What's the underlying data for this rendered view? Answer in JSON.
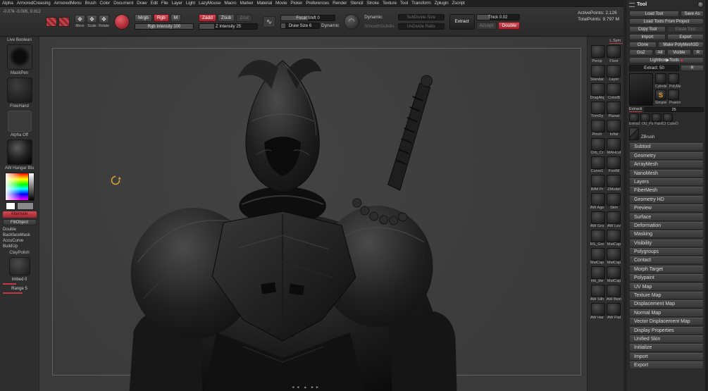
{
  "menu": {
    "items": [
      "Alpha",
      "ArmoredCreasing",
      "ArmoredMenu",
      "Brush",
      "Color",
      "Document",
      "Draw",
      "Edit",
      "File",
      "Layer",
      "Light",
      "LazyMouse",
      "Macro",
      "Marker",
      "Material",
      "Movie",
      "Picker",
      "Preferences",
      "Render",
      "Stencil",
      "Stroke",
      "Texture",
      "Tool",
      "Transform",
      "Zplugin",
      "Zscript"
    ]
  },
  "toolbar": {
    "coords": "-0.07k -0.005, 0.012",
    "tool_buttons": [
      "Move",
      "Scale",
      "Rotate"
    ],
    "mrgb": "Mrgb",
    "rgb": "Rgb",
    "m": "M",
    "rgb_intensity": "Rgb Intensity 100",
    "zadd": "Zadd",
    "zsub": "Zsub",
    "zcut": "Zcut",
    "z_intensity": "Z Intensity 25",
    "focal_shift": "Focal Shift 0",
    "draw_size": "Draw Size 6",
    "dynamic_small": "Dynamic",
    "dynamic": "Dynamic",
    "smooth_subdiv": "SmoothSubdiv",
    "subdivide_size": "SubDivide Size",
    "undivide_ratio": "UnDivide Ratio",
    "thick": "Thick 0.02",
    "extract": "Extract",
    "accept": "Accept",
    "double": "Double",
    "active_points": "ActivePoints: 2,126",
    "total_points": "TotalPoints: 9.797 M"
  },
  "left_shelf": {
    "live_boolean": "Live Boolean",
    "maskpen": "MaskPen",
    "freehand": "FreeHand",
    "alpha_off": "Alpha Off",
    "material": "AW Hangar Blu",
    "alternate": "Alternate",
    "fill_object": "FillObject",
    "toggles": [
      "Double",
      "BackfaceMask",
      "AccuCurve",
      "BuildUp"
    ],
    "clay_polish": "ClayPolish",
    "imbed": "Imbed 0",
    "range": "Range 5"
  },
  "canvas": {
    "nav_hint": "◄◄ ▲ ►►"
  },
  "right_tray": {
    "lsym": "L.Sym",
    "persp": "Persp",
    "floor": "Floor",
    "rows": [
      {
        "a": "Standar",
        "b": "Layer"
      },
      {
        "a": "DragAlq",
        "b": "ColorB"
      },
      {
        "a": "TrimDy",
        "b": "Planar"
      },
      {
        "a": "Pinch",
        "b": "Inflat"
      },
      {
        "a": "Orb_Cr",
        "b": "MAHcut"
      },
      {
        "a": "Curve1",
        "b": "FootM"
      },
      {
        "a": "IMM Pr",
        "b": "ZModel"
      },
      {
        "a": "AW Age",
        "b": "Skin"
      },
      {
        "a": "AW Gra",
        "b": "AW Lev"
      },
      {
        "a": "RS_Gre",
        "b": "MatCap"
      },
      {
        "a": "MatCap",
        "b": "MatCap"
      },
      {
        "a": "mb_bw",
        "b": "MatCap"
      },
      {
        "a": "AW Silh",
        "b": "AW Bion"
      },
      {
        "a": "AW Har",
        "b": "AW Flat"
      }
    ]
  },
  "tool_panel": {
    "title": "Tool",
    "load_tool": "Load Tool",
    "save_as": "Save As",
    "load_tools_project": "Load Tools From Project",
    "copy_tool": "Copy Tool",
    "paste_tool": "Paste Tool",
    "import": "Import",
    "export": "Export",
    "clone": "Clone",
    "make_polymesh": "Make PolyMesh3D",
    "goz": "GoZ",
    "all": "All",
    "visible": "Visible",
    "r": "R",
    "lightbox_tools": "Lightbox▶Tools",
    "extract_slider": "Extract: 50",
    "extract_r": "R",
    "quick": {
      "row1": [
        "Cylinde",
        "PolyMe"
      ],
      "row2": [
        "Simplel",
        "Praetor"
      ],
      "extract_label": "Extracti",
      "extract_value": "25",
      "row3": [
        "Extract",
        "OU_Par",
        "PaintCk",
        "CubeDC"
      ],
      "brand": "ZBrush"
    },
    "sections": [
      "Subtool",
      "Geometry",
      "ArrayMesh",
      "NanoMesh",
      "Layers",
      "FiberMesh",
      "Geometry HD",
      "Preview",
      "Surface",
      "Deformation",
      "Masking",
      "Visibility",
      "Polygroups",
      "Contact",
      "Morph Target",
      "Polypaint",
      "UV Map",
      "Texture Map",
      "Displacement Map",
      "Normal Map",
      "Vector Displacement Map",
      "Display Properties",
      "Unified Skin",
      "Initialize",
      "Import",
      "Export"
    ]
  }
}
